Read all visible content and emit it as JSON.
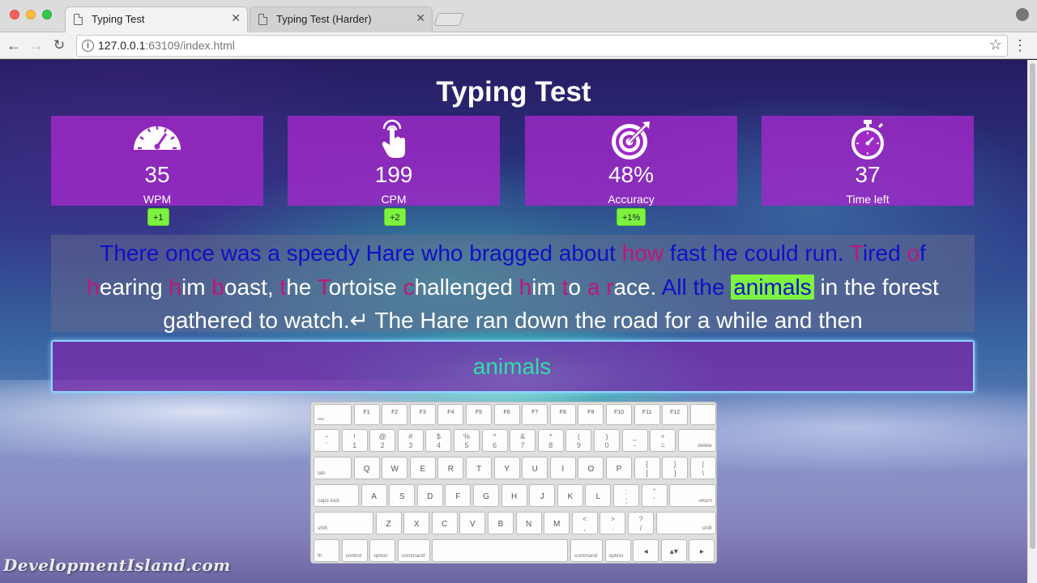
{
  "browser": {
    "tabs": [
      {
        "label": "Typing Test",
        "active": true
      },
      {
        "label": "Typing Test (Harder)",
        "active": false
      }
    ],
    "url_host": "127.0.0.1",
    "url_rest": ":63109/index.html"
  },
  "page": {
    "title": "Typing Test",
    "stats": [
      {
        "value": "35",
        "label": "WPM",
        "delta": "+1",
        "icon": "speedometer-icon"
      },
      {
        "value": "199",
        "label": "CPM",
        "delta": "+2",
        "icon": "pointer-hand-icon"
      },
      {
        "value": "48%",
        "label": "Accuracy",
        "delta": "+1%",
        "icon": "target-icon"
      },
      {
        "value": "37",
        "label": "Time left",
        "delta": "",
        "icon": "stopwatch-icon"
      }
    ],
    "passage": [
      {
        "t": "There once was a speedy Hare who bragged about ",
        "s": "ok"
      },
      {
        "t": "how",
        "s": "bad"
      },
      {
        "t": " fast he could run. ",
        "s": "ok"
      },
      {
        "t": "T",
        "s": "bad"
      },
      {
        "t": "ired ",
        "s": "ok"
      },
      {
        "t": "o",
        "s": "bad"
      },
      {
        "t": "f ",
        "s": "ok"
      },
      {
        "t": "h",
        "s": "bad"
      },
      {
        "t": "earing ",
        "s": "plain"
      },
      {
        "t": "h",
        "s": "bad"
      },
      {
        "t": "im ",
        "s": "plain"
      },
      {
        "t": "b",
        "s": "bad"
      },
      {
        "t": "oast, ",
        "s": "plain"
      },
      {
        "t": "t",
        "s": "bad"
      },
      {
        "t": "he ",
        "s": "plain"
      },
      {
        "t": "T",
        "s": "bad"
      },
      {
        "t": "ortoise ",
        "s": "plain"
      },
      {
        "t": "c",
        "s": "bad"
      },
      {
        "t": "hallenged ",
        "s": "plain"
      },
      {
        "t": "h",
        "s": "bad"
      },
      {
        "t": "im ",
        "s": "plain"
      },
      {
        "t": "t",
        "s": "bad"
      },
      {
        "t": "o ",
        "s": "plain"
      },
      {
        "t": "a",
        "s": "bad"
      },
      {
        "t": " ",
        "s": "plain"
      },
      {
        "t": "r",
        "s": "bad"
      },
      {
        "t": "ace. ",
        "s": "plain"
      },
      {
        "t": "All the ",
        "s": "ok"
      },
      {
        "t": "animals",
        "s": "cur"
      },
      {
        "t": " in the forest gathered to watch.↵ The Hare ran down the road for a while and then",
        "s": "plain"
      }
    ],
    "input_value": "animals"
  },
  "keyboard": {
    "fn_row": [
      "esc",
      "F1",
      "F2",
      "F3",
      "F4",
      "F5",
      "F6",
      "F7",
      "F8",
      "F9",
      "F10",
      "F11",
      "F12",
      ""
    ],
    "num_row": [
      [
        "~",
        "`"
      ],
      [
        "!",
        "1"
      ],
      [
        "@",
        "2"
      ],
      [
        "#",
        "3"
      ],
      [
        "$",
        "4"
      ],
      [
        "%",
        "5"
      ],
      [
        "^",
        "6"
      ],
      [
        "&",
        "7"
      ],
      [
        "*",
        "8"
      ],
      [
        "(",
        "9"
      ],
      [
        ")",
        "0"
      ],
      [
        "_",
        "-"
      ],
      [
        "+",
        "="
      ],
      [
        "",
        "delete"
      ]
    ],
    "q_row": [
      "tab",
      "Q",
      "W",
      "E",
      "R",
      "T",
      "Y",
      "U",
      "I",
      "O",
      "P",
      [
        "{",
        "["
      ],
      [
        "}",
        "]"
      ],
      [
        "|",
        "\\"
      ]
    ],
    "a_row": [
      "caps lock",
      "A",
      "S",
      "D",
      "F",
      "G",
      "H",
      "J",
      "K",
      "L",
      [
        ":",
        ";"
      ],
      [
        "\"",
        "'"
      ],
      "return"
    ],
    "z_row": [
      "shift",
      "Z",
      "X",
      "C",
      "V",
      "B",
      "N",
      "M",
      [
        "<",
        ","
      ],
      [
        ">",
        "."
      ],
      [
        "?",
        "/"
      ],
      "shift"
    ],
    "bottom_row": [
      "fn",
      "control",
      "option",
      "command",
      "",
      "command",
      "option",
      "◂",
      "▴▾",
      "▸"
    ]
  },
  "watermark": "DevelopmentIsland.com"
}
